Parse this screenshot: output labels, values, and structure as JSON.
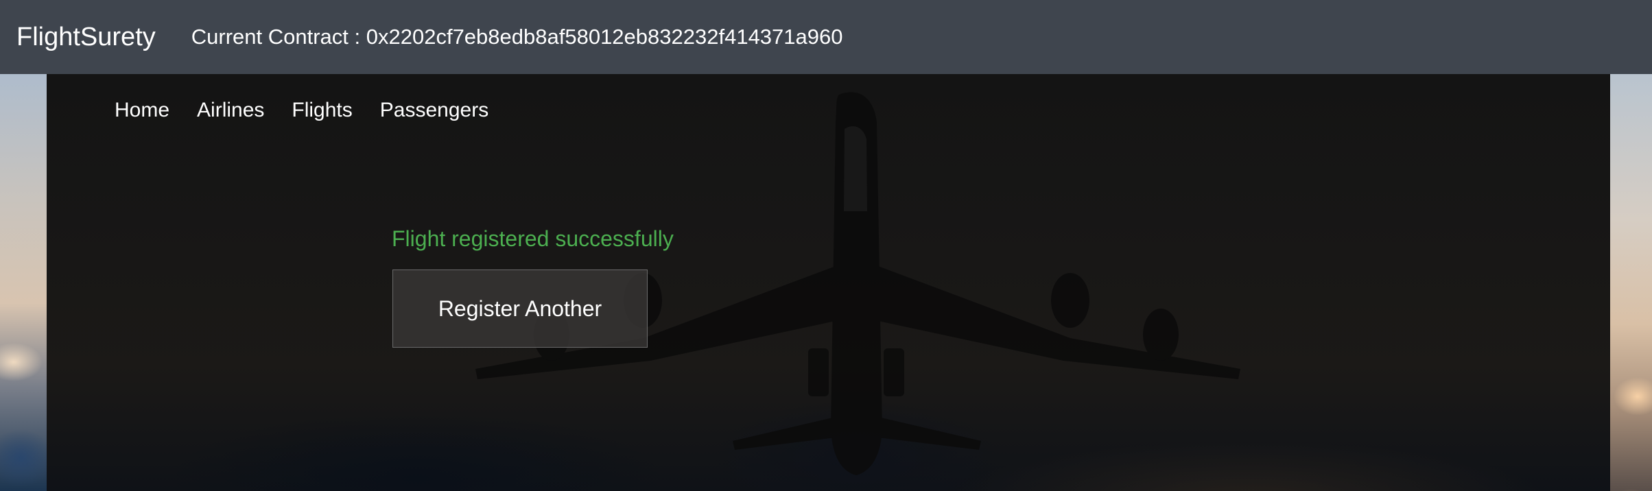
{
  "header": {
    "brand": "FlightSurety",
    "contract_label": "Current Contract :",
    "contract_address": "0x2202cf7eb8edb8af58012eb832232f414371a960"
  },
  "nav": {
    "items": [
      {
        "label": "Home"
      },
      {
        "label": "Airlines"
      },
      {
        "label": "Flights"
      },
      {
        "label": "Passengers"
      }
    ]
  },
  "main": {
    "status_message": "Flight registered successfully",
    "status_color": "#4caf50",
    "register_another_label": "Register Another"
  },
  "colors": {
    "topbar": "#3f454e",
    "panel": "#161616"
  }
}
